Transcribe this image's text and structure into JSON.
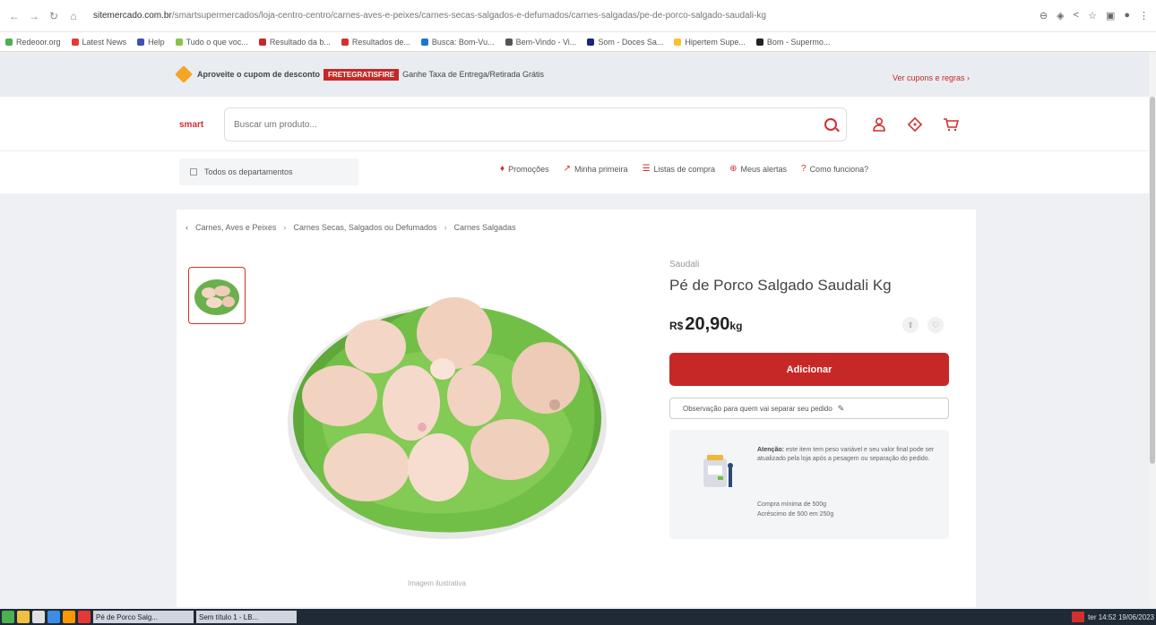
{
  "browser": {
    "url_domain": "sitemercado.com.br",
    "url_path": "/smartsupermercados/loja-centro-centro/carnes-aves-e-peixes/carnes-secas-salgados-e-defumados/carnes-salgadas/pe-de-porco-salgado-saudali-kg",
    "bookmarks": [
      "Redeoor.org",
      "Latest News",
      "Help",
      "Tudo o que voc...",
      "Resultado da b...",
      "Resultados de...",
      "Busca: Bom-Vu...",
      "Bem-Vindo - Vi...",
      "Som - Doces Sa...",
      "Hipertem Supe...",
      "Bom - Supermo..."
    ]
  },
  "promo": {
    "text_before": "Aproveite o cupom de desconto",
    "coupon": "FRETEGRATISFIRE",
    "text_after": "Ganhe Taxa de Entrega/Retirada Grátis",
    "link": "Ver cupons e regras ›"
  },
  "header": {
    "logo": "smart",
    "search_placeholder": "Buscar um produto..."
  },
  "nav": {
    "departments": "Todos os departamentos",
    "links": [
      "Promoções",
      "Minha primeira",
      "Listas de compra",
      "Meus alertas",
      "Como funciona?"
    ]
  },
  "breadcrumb": [
    "Carnes, Aves e Peixes",
    "Carnes Secas, Salgados ou Defumados",
    "Carnes Salgadas"
  ],
  "product": {
    "brand": "Saudali",
    "title": "Pé de Porco Salgado Saudali Kg",
    "price_currency": "R$",
    "price_value": "20,90",
    "price_unit": "kg",
    "add_button": "Adicionar",
    "observation_button": "Observação para quem vai separar seu pedido",
    "caption": "Imagem ilustrativa",
    "info_bold": "Atenção:",
    "info_text": "este item tem peso variável e seu valor final pode ser atualizado pela loja após a pesagem ou separação do pedido.",
    "info_min": "Compra mínima de 500g",
    "info_step": "Acréscimo de 500 em 250g"
  },
  "taskbar": {
    "tasks": [
      "Pé de Porco Salg...",
      "Sem título 1 - LB..."
    ],
    "clock": "ter 14:52 19/06/2023"
  }
}
